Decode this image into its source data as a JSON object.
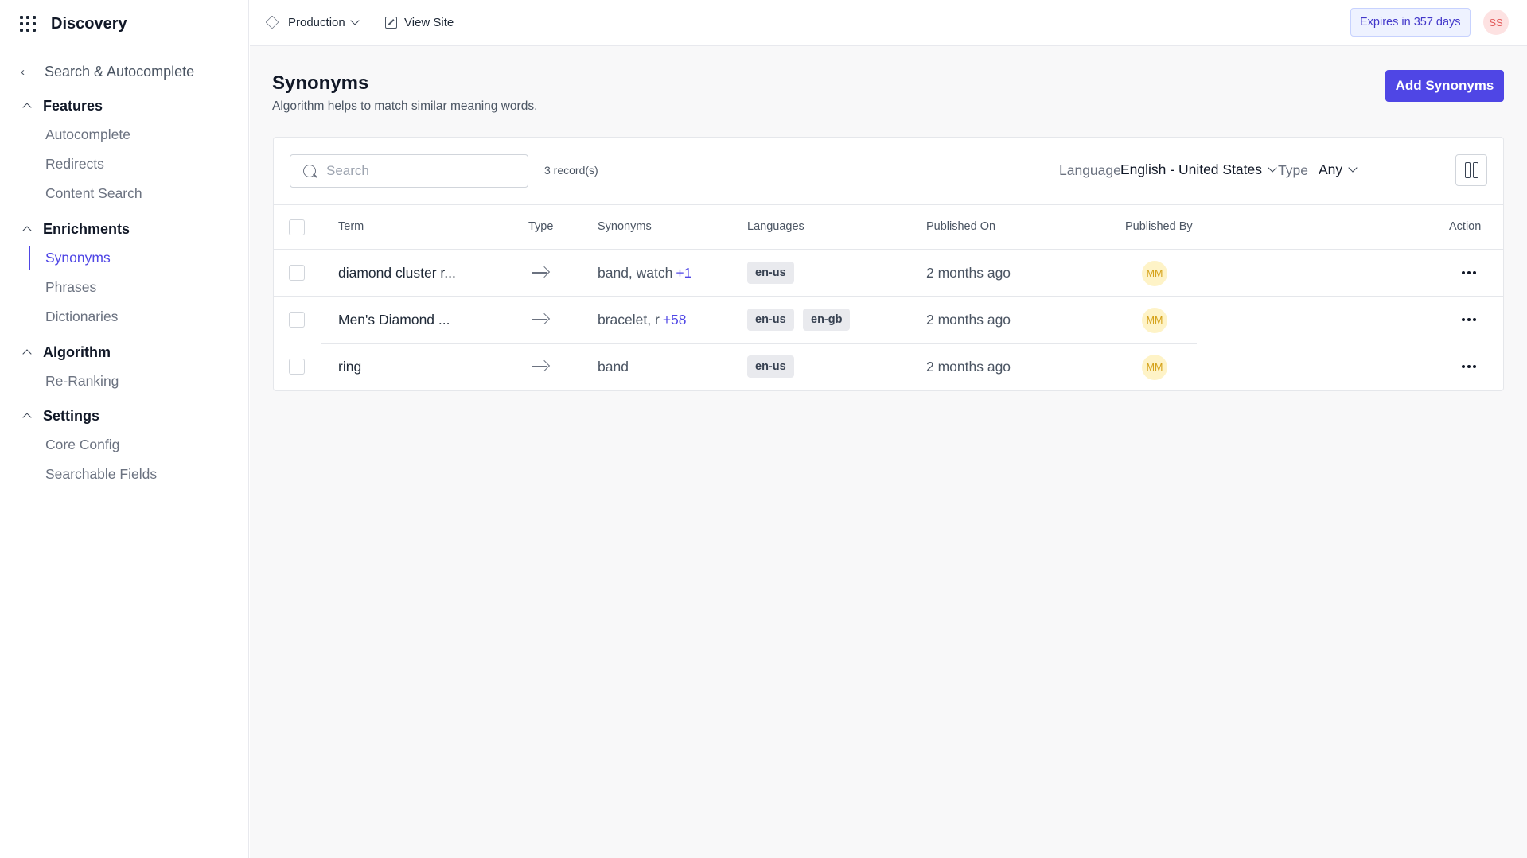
{
  "app": {
    "name": "Discovery"
  },
  "sidebar": {
    "back_label": "Search & Autocomplete",
    "sections": [
      {
        "title": "Features",
        "items": [
          "Autocomplete",
          "Redirects",
          "Content Search"
        ]
      },
      {
        "title": "Enrichments",
        "items": [
          "Synonyms",
          "Phrases",
          "Dictionaries"
        ],
        "active": "Synonyms"
      },
      {
        "title": "Algorithm",
        "items": [
          "Re-Ranking"
        ]
      },
      {
        "title": "Settings",
        "items": [
          "Core Config",
          "Searchable Fields"
        ]
      }
    ]
  },
  "topbar": {
    "environment": "Production",
    "view_site": "View Site",
    "expires": "Expires in 357 days",
    "user_initials": "SS"
  },
  "page": {
    "title": "Synonyms",
    "subtitle": "Algorithm helps to match similar meaning words.",
    "add_button": "Add Synonyms"
  },
  "toolbar": {
    "search_placeholder": "Search",
    "records": "3 record(s)",
    "language_label": "Language",
    "language_value": "English - United States",
    "type_label": "Type",
    "type_value": "Any"
  },
  "table": {
    "headers": {
      "term": "Term",
      "type": "Type",
      "synonyms": "Synonyms",
      "languages": "Languages",
      "published_on": "Published On",
      "published_by": "Published By",
      "action": "Action"
    },
    "rows": [
      {
        "term": "diamond cluster r...",
        "synonyms": "band, watch",
        "more": "+1",
        "languages": [
          "en-us"
        ],
        "published_on": "2 months ago",
        "published_by": "MM"
      },
      {
        "term": "Men's Diamond ...",
        "synonyms": "bracelet, r",
        "more": "+58",
        "languages": [
          "en-us",
          "en-gb"
        ],
        "published_on": "2 months ago",
        "published_by": "MM"
      },
      {
        "term": "ring",
        "synonyms": "band",
        "more": "",
        "languages": [
          "en-us"
        ],
        "published_on": "2 months ago",
        "published_by": "MM"
      }
    ]
  },
  "colors": {
    "accent": "#4f46e5",
    "expires_bg": "#eef2ff",
    "avatar_user_bg": "#fde2e2",
    "avatar_mm_bg": "#fef3c7"
  },
  "icons": [
    "apps-grid-icon",
    "chevron-left-icon",
    "chevron-up-icon",
    "cube-icon",
    "chevron-down-icon",
    "external-link-icon",
    "search-icon",
    "columns-icon",
    "arrow-right-icon",
    "more-horizontal-icon"
  ]
}
